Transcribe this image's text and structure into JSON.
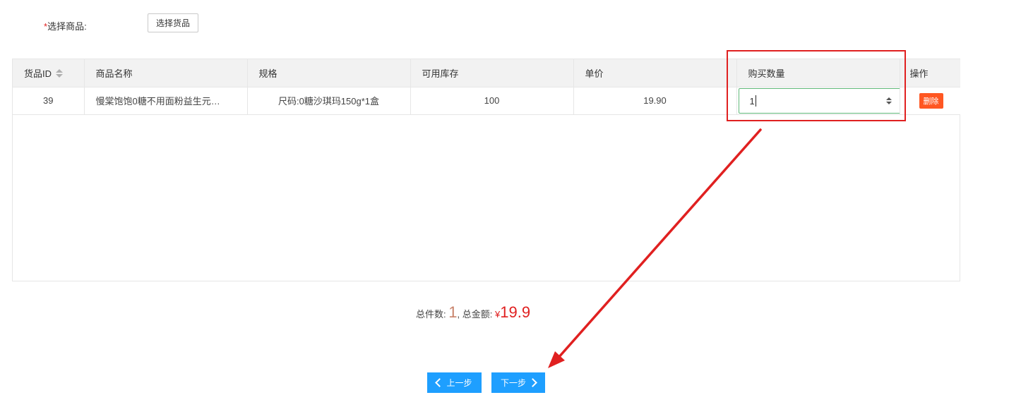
{
  "form": {
    "required_mark": "*",
    "select_label": "选择商品:",
    "select_button": "选择货品"
  },
  "table": {
    "columns": [
      "货品ID",
      "商品名称",
      "规格",
      "可用库存",
      "单价",
      "购买数量",
      "操作"
    ],
    "rows": [
      {
        "id": "39",
        "name": "慢棠饱饱0糖不用面粉益生元…",
        "spec": "尺码:0糖沙琪玛150g*1盒",
        "stock": "100",
        "price": "19.90",
        "quantity": "1",
        "action": "删除"
      }
    ]
  },
  "summary": {
    "count_label": "总件数:",
    "count": "1",
    "separator": ",",
    "amount_label": "总金额:",
    "currency": "¥",
    "amount": "19.9"
  },
  "buttons": {
    "prev": "上一步",
    "next": "下一步"
  },
  "colors": {
    "primary": "#1e9fff",
    "danger": "#ff5722",
    "annotation": "#e02020"
  }
}
